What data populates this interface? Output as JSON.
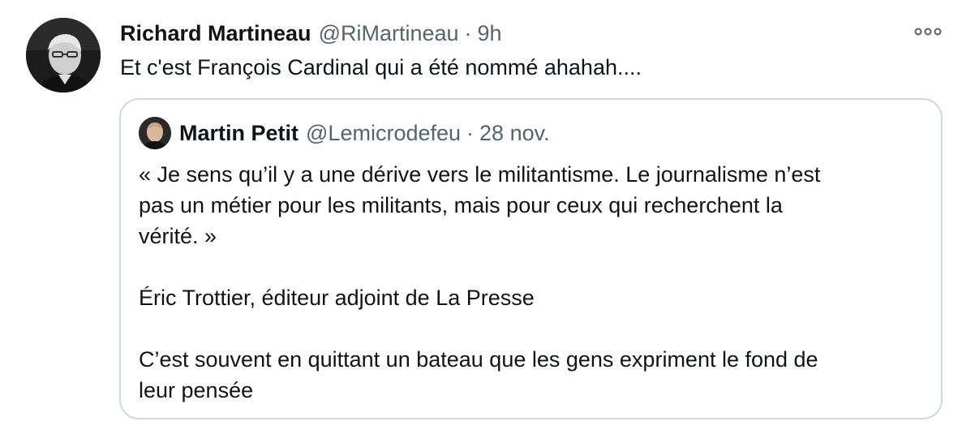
{
  "tweet": {
    "author_name": "Richard Martineau",
    "author_handle": "@RiMartineau",
    "separator": "·",
    "time": "9h",
    "text": "Et c'est François Cardinal qui a été nommé ahahah....",
    "avatar_icon": "user-avatar-photo",
    "more_icon": "more-options-icon"
  },
  "quoted_tweet": {
    "author_name": "Martin Petit",
    "author_handle": "@Lemicrodefeu",
    "separator": "·",
    "date": "28 nov.",
    "avatar_icon": "user-avatar-photo",
    "paragraphs": [
      "« Je sens qu’il y a une dérive vers le militantisme. Le journalisme n’est\npas un métier pour les militants, mais pour ceux qui recherchent la\nvérité. »",
      "Éric Trottier, éditeur adjoint de La Presse",
      "C’est souvent en quittant un bateau que les gens expriment le fond de\nleur pensée"
    ]
  },
  "colors": {
    "text_primary": "#0f1419",
    "text_secondary": "#536471",
    "border": "#cfd9de",
    "background": "#ffffff"
  }
}
